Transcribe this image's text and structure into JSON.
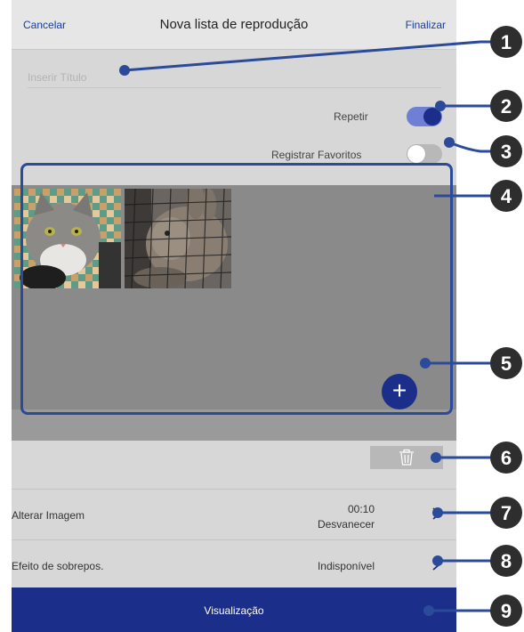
{
  "header": {
    "cancel_label": "Cancelar",
    "title": "Nova lista de reprodução",
    "done_label": "Finalizar"
  },
  "title_field": {
    "placeholder": "Inserir Título",
    "value": ""
  },
  "settings": {
    "repeat_label": "Repetir",
    "repeat_on": true,
    "favorites_label": "Registrar Favoritos",
    "favorites_on": false
  },
  "media": {
    "items": [
      {
        "name": "cat-photo"
      },
      {
        "name": "rabbit-photo"
      }
    ],
    "add_icon": "plus-icon",
    "delete_icon": "trash-icon"
  },
  "rows": {
    "change_image": {
      "label": "Alterar Imagem",
      "duration": "00:10",
      "transition": "Desvanecer"
    },
    "overlay": {
      "label": "Efeito de sobrepos.",
      "value": "Indisponível"
    }
  },
  "preview_label": "Visualização",
  "callouts": [
    "1",
    "2",
    "3",
    "4",
    "5",
    "6",
    "7",
    "8",
    "9"
  ],
  "colors": {
    "accent": "#1b2f8a",
    "toggle_on_track": "#6f7fd6",
    "callout_badge": "#2e2e2e",
    "callout_line": "#2b4a9a"
  }
}
